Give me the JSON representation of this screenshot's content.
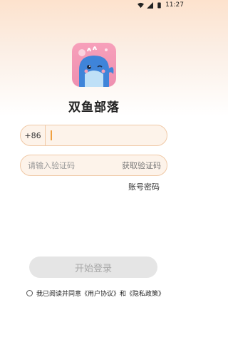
{
  "status_bar": {
    "time": "11:27",
    "icons": [
      "wifi-icon",
      "signal-icon",
      "battery-icon"
    ]
  },
  "app": {
    "name": "双鱼部落",
    "logo_icon": "whale-logo-icon"
  },
  "phone": {
    "country_code": "+86",
    "value": ""
  },
  "code": {
    "placeholder": "请输入验证码",
    "get_code_label": "获取验证码"
  },
  "password_link": "账号密码",
  "start_button": "开始登录",
  "agreement": {
    "text": "我已阅读并同意《用户协议》和《隐私政策》"
  },
  "colors": {
    "field_border": "#f0c9a6",
    "field_bg": "#fdf3ea",
    "caret": "#f0a040",
    "logo_bg": "#f7a0ba",
    "whale": "#3f84d9"
  }
}
